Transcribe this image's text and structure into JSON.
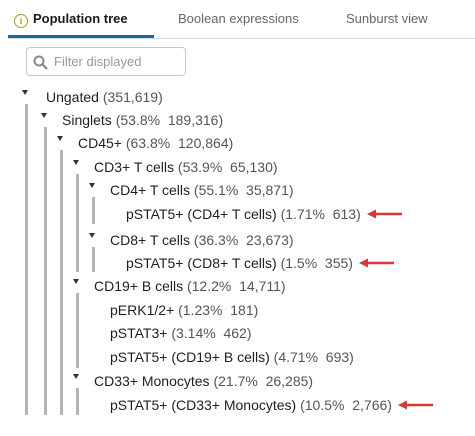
{
  "tabs": [
    {
      "label": "Population tree",
      "active": true
    },
    {
      "label": "Boolean expressions",
      "active": false
    },
    {
      "label": "Sunburst view",
      "active": false
    }
  ],
  "search": {
    "placeholder": "Filter displayed",
    "value": ""
  },
  "icons": {
    "tab_info": "info-icon",
    "search": "search-icon",
    "expander": "caret-down-icon",
    "marker": "arrow-left-icon"
  },
  "colors": {
    "accent": "#1565a8",
    "arrow": "#d9383b",
    "tree_line": "#b4b4b4",
    "info": "#b59a12"
  },
  "tree": {
    "nodes": [
      {
        "name": "Ungated",
        "stats": "(351,619)",
        "marked": false
      },
      {
        "name": "Singlets",
        "stats": "(53.8%  189,316)",
        "marked": false
      },
      {
        "name": "CD45+",
        "stats": "(63.8%  120,864)",
        "marked": false
      },
      {
        "name": "CD3+ T cells",
        "stats": "(53.9%  65,130)",
        "marked": false
      },
      {
        "name": "CD4+ T cells",
        "stats": "(55.1%  35,871)",
        "marked": false
      },
      {
        "name": "pSTAT5+ (CD4+ T cells)",
        "stats": "(1.71%  613)",
        "marked": true
      },
      {
        "name": "CD8+ T cells",
        "stats": "(36.3%  23,673)",
        "marked": false
      },
      {
        "name": "pSTAT5+ (CD8+ T cells)",
        "stats": "(1.5%  355)",
        "marked": true
      },
      {
        "name": "CD19+ B cells",
        "stats": "(12.2%  14,711)",
        "marked": false
      },
      {
        "name": "pERK1/2+",
        "stats": "(1.23%  181)",
        "marked": false
      },
      {
        "name": "pSTAT3+",
        "stats": "(3.14%  462)",
        "marked": false
      },
      {
        "name": "pSTAT5+ (CD19+ B cells)",
        "stats": "(4.71%  693)",
        "marked": false
      },
      {
        "name": "CD33+ Monocytes",
        "stats": "(21.7%  26,285)",
        "marked": false
      },
      {
        "name": "pSTAT5+ (CD33+ Monocytes)",
        "stats": "(10.5%  2,766)",
        "marked": true
      }
    ]
  }
}
